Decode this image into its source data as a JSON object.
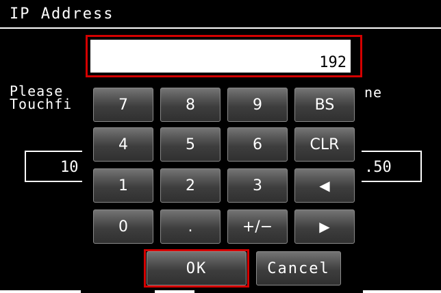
{
  "title": "IP Address",
  "background": {
    "left_text_line1": "Please",
    "left_text_line2": "Touchfi",
    "right_text": "ne",
    "left_box_value": "10",
    "right_box_value": ".50"
  },
  "entry": {
    "value": "192"
  },
  "keypad": {
    "keys": [
      {
        "label": "7",
        "name": "key-7"
      },
      {
        "label": "8",
        "name": "key-8"
      },
      {
        "label": "9",
        "name": "key-9"
      },
      {
        "label": "BS",
        "name": "backspace-key"
      },
      {
        "label": "4",
        "name": "key-4"
      },
      {
        "label": "5",
        "name": "key-5"
      },
      {
        "label": "6",
        "name": "key-6"
      },
      {
        "label": "CLR",
        "name": "clear-key"
      },
      {
        "label": "1",
        "name": "key-1"
      },
      {
        "label": "2",
        "name": "key-2"
      },
      {
        "label": "3",
        "name": "key-3"
      },
      {
        "label": "◀",
        "name": "left-arrow-key"
      },
      {
        "label": "0",
        "name": "key-0"
      },
      {
        "label": ".",
        "name": "decimal-point-key"
      },
      {
        "label": "+/−",
        "name": "sign-toggle-key"
      },
      {
        "label": "▶",
        "name": "right-arrow-key"
      }
    ]
  },
  "buttons": {
    "ok": "OK",
    "cancel": "Cancel"
  },
  "colors": {
    "highlight": "#d40000",
    "background": "#000000",
    "key_face": "#3e3e3e"
  }
}
